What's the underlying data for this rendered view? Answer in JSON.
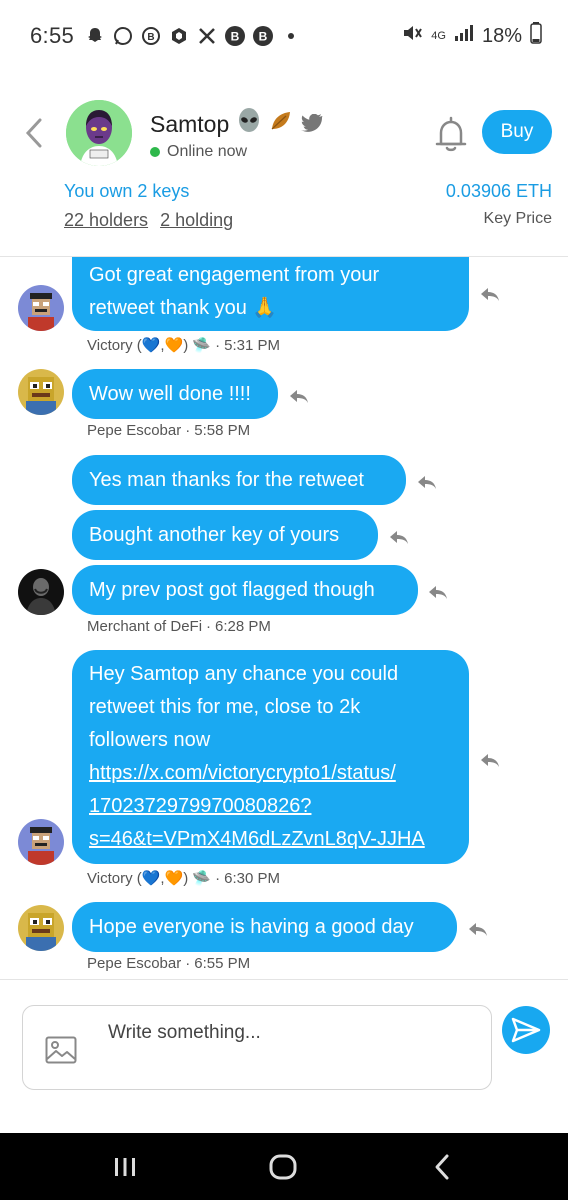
{
  "status_bar": {
    "time": "6:55",
    "network": "4G",
    "battery": "18%"
  },
  "header": {
    "name": "Samtop",
    "status": "Online now",
    "buy_label": "Buy",
    "keys_owned": "You own 2 keys",
    "holders": "22 holders",
    "holding": "2 holding",
    "key_price": "0.03906 ETH",
    "key_price_label": "Key Price"
  },
  "messages": [
    {
      "line1": "Got great engagement from your",
      "line2": "retweet thank you 🙏",
      "author": "Victory (💙,🧡) 🛸",
      "time": "5:31 PM"
    },
    {
      "text": "Wow well done !!!!",
      "author": "Pepe Escobar",
      "time": "5:58 PM"
    },
    {
      "text": "Yes man thanks for the retweet"
    },
    {
      "text": "Bought another key of yours"
    },
    {
      "text": "My prev post got flagged though",
      "author": "Merchant of DeFi",
      "time": "6:28 PM"
    },
    {
      "line1": "Hey Samtop any chance you could",
      "line2": "retweet this for me, close to 2k",
      "line3": "followers now",
      "link1": "https://x.com/victorycrypto1/status/",
      "link2": "1702372979970080826?",
      "link3": "s=46&t=VPmX4M6dLzZvnL8qV-JJHA",
      "author": "Victory (💙,🧡) 🛸",
      "time": "6:30 PM"
    },
    {
      "text": "Hope everyone is having a good day",
      "author": "Pepe Escobar",
      "time": "6:55 PM"
    }
  ],
  "composer": {
    "placeholder": "Write something..."
  },
  "colors": {
    "accent": "#18a8f0",
    "online": "#2eb84b"
  }
}
